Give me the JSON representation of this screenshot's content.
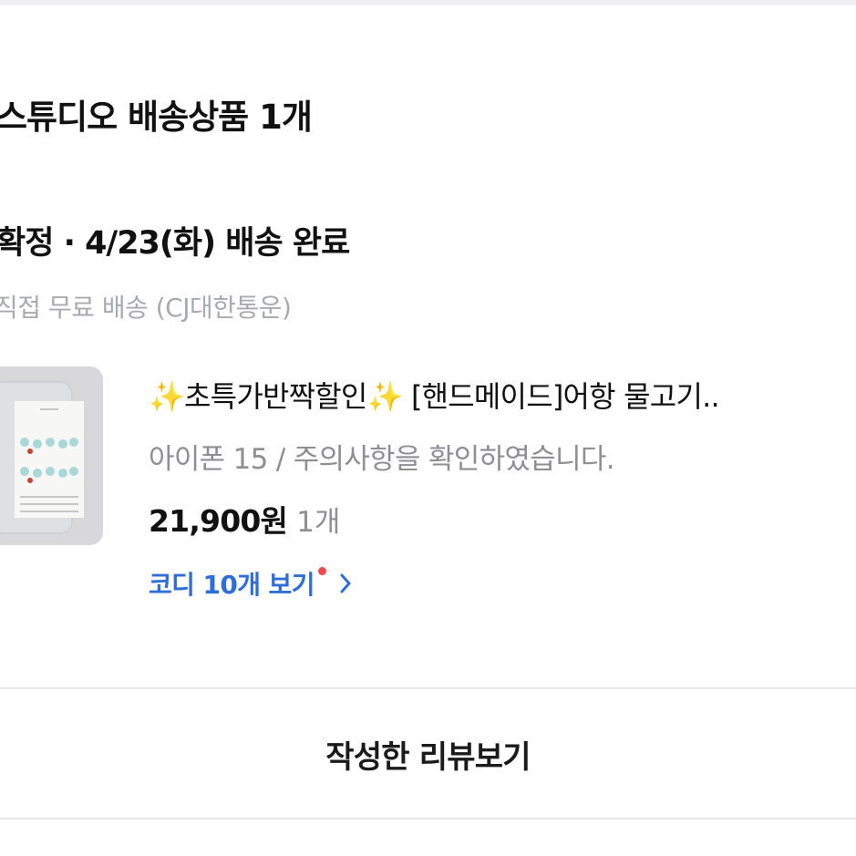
{
  "order": {
    "shop_title": "스튜디오 배송상품 1개",
    "status": "확정 · 4/23(화) 배송 완료",
    "shipping": "직접 무료 배송 (CJ대한통운)"
  },
  "item": {
    "sparkle_left": "✨",
    "title_part1": "초특가반짝할인",
    "sparkle_mid": "✨",
    "title_part2": " [핸드메이드]어항 물고기..",
    "option": "아이폰 15 / 주의사항을 확인하였습니다.",
    "price": "21,900원",
    "quantity": "1개",
    "thumbnail_icon": "product-photo-icon"
  },
  "codi": {
    "label": "코디 10개 보기",
    "chevron_icon": "chevron-right-icon"
  },
  "actions": {
    "review_label": "작성한 리뷰보기"
  },
  "colors": {
    "link": "#2f6ed7",
    "new_dot": "#f0484b",
    "muted": "#8e8e93",
    "sparkle": "#f0c431"
  }
}
